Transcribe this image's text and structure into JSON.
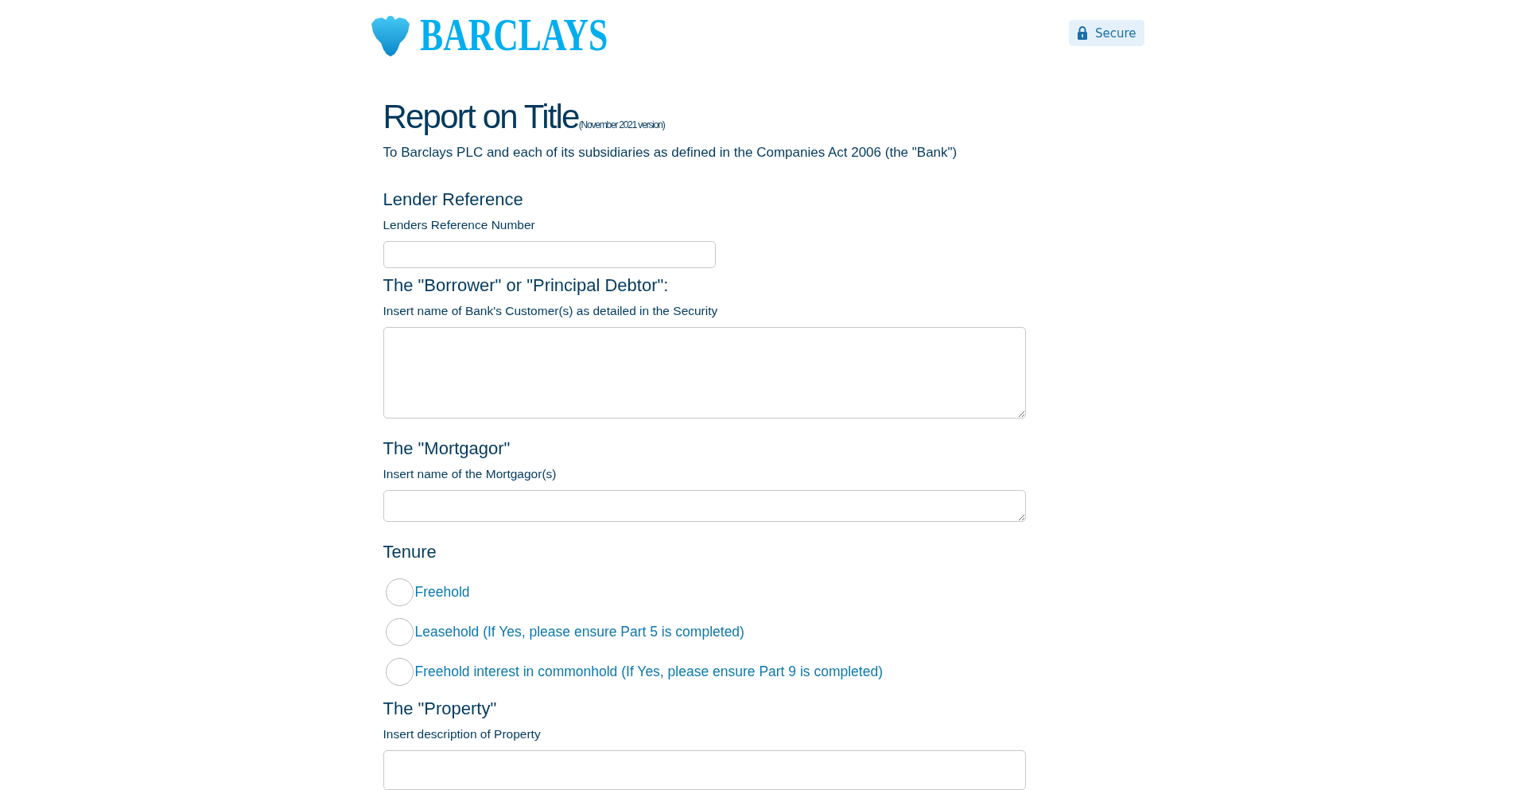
{
  "header": {
    "logo": "BARCLAYS",
    "badge": "Secure"
  },
  "title": {
    "heading": "Report on Title",
    "version": "(November 2021 version)"
  },
  "intro": "To Barclays PLC and each of its subsidiaries as defined in the Companies Act 2006 (the \"Bank\")",
  "sections": [
    {
      "heading": "Lender Reference",
      "label": "Lenders Reference Number",
      "kind": "input"
    },
    {
      "heading": "The \"Borrower\" or \"Principal Debtor\":",
      "label": "Insert name of Bank's Customer(s) as detailed in the Security",
      "kind": "textarea"
    },
    {
      "heading": "The \"Mortgagor\"",
      "label": "Insert name of the Mortgagor(s)",
      "kind": "textline"
    },
    {
      "heading": "Tenure",
      "kind": "radios",
      "options": [
        {
          "label": "Freehold",
          "selected": false
        },
        {
          "label": "Leasehold (If Yes, please ensure Part 5 is completed)",
          "selected": false
        },
        {
          "label": "Freehold interest in commonhold (If Yes, please ensure Part 9 is completed)",
          "selected": false
        }
      ]
    },
    {
      "heading": "The \"Property\"",
      "label": "Insert description of Property",
      "kind": "textarea"
    }
  ]
}
